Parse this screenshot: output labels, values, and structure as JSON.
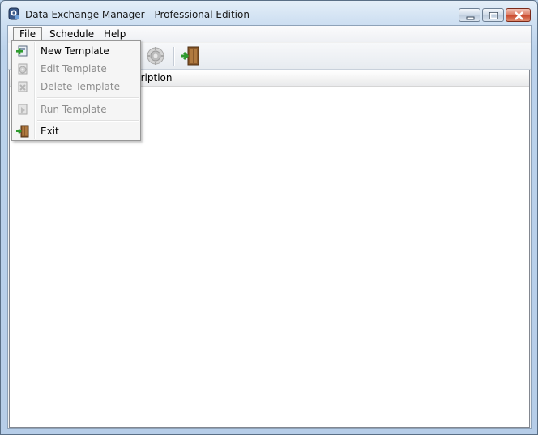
{
  "window": {
    "title": "Data Exchange Manager - Professional Edition"
  },
  "menubar": {
    "items": [
      {
        "label": "File"
      },
      {
        "label": "Schedule"
      },
      {
        "label": "Help"
      }
    ]
  },
  "file_menu": {
    "items": [
      {
        "label": "New Template",
        "icon": "new-template-icon",
        "enabled": true
      },
      {
        "label": "Edit Template",
        "icon": "edit-template-icon",
        "enabled": false
      },
      {
        "label": "Delete Template",
        "icon": "delete-template-icon",
        "enabled": false
      },
      {
        "label": "Run Template",
        "icon": "run-template-icon",
        "enabled": false
      },
      {
        "label": "Exit",
        "icon": "exit-door-icon",
        "enabled": true
      }
    ]
  },
  "list": {
    "columns": [
      {
        "label": "cription"
      }
    ]
  },
  "colors": {
    "accent_green": "#2e9a2e",
    "door_brown": "#8a5a2b"
  }
}
